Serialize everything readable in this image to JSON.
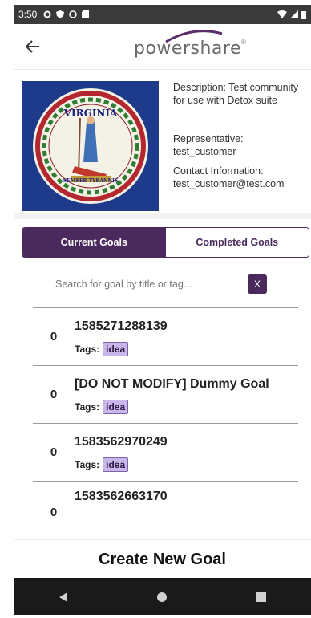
{
  "status_bar": {
    "time": "3:50"
  },
  "app_bar": {
    "logo_text": "powershare",
    "logo_mark": "®"
  },
  "community": {
    "seal_top_text": "VIRGINIA",
    "seal_bottom_text": "SEMPER TYRANNIS",
    "description": "Description: Test community for use with Detox suite",
    "representative_label": "Representative:",
    "representative_value": "test_customer",
    "contact_label": "Contact Information:",
    "contact_value": "test_customer@test.com"
  },
  "tabs": {
    "current": "Current Goals",
    "completed": "Completed Goals"
  },
  "search": {
    "placeholder": "Search for goal by title or tag...",
    "clear_label": "X"
  },
  "goals": [
    {
      "count": "0",
      "title": "1585271288139",
      "tags_label": "Tags:",
      "tag": "idea"
    },
    {
      "count": "0",
      "title": "[DO NOT MODIFY] Dummy Goal",
      "tags_label": "Tags:",
      "tag": "idea"
    },
    {
      "count": "0",
      "title": "1583562970249",
      "tags_label": "Tags:",
      "tag": "idea"
    },
    {
      "count": "0",
      "title": "1583562663170"
    }
  ],
  "create_button": "Create New Goal",
  "colors": {
    "accent": "#4a2a5c",
    "tag_bg": "#c9b6ea",
    "seal_bg": "#1e3a8a"
  }
}
